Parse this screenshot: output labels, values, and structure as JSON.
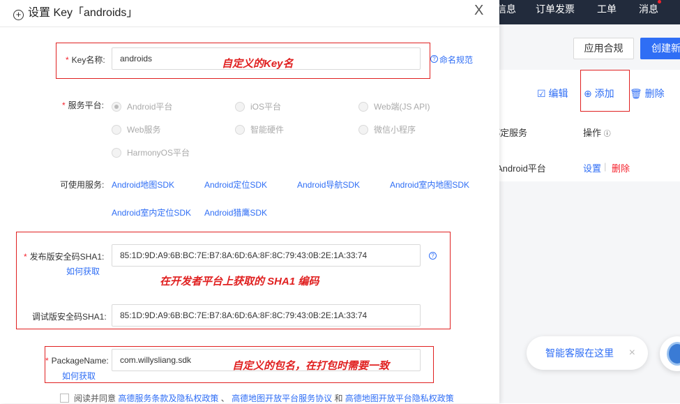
{
  "background": {
    "topnav": [
      "信息",
      "订单发票",
      "工单",
      "消息"
    ],
    "buttons": {
      "compliance": "应用合规",
      "create": "创建新"
    },
    "toolbar": {
      "edit": "编辑",
      "add": "添加",
      "delete": "删除"
    },
    "table": {
      "headers": {
        "service": "绑定服务",
        "actions": "操作"
      },
      "row": {
        "service": "Android平台",
        "settings": "设置",
        "delete": "删除"
      }
    },
    "chat": {
      "label": "智能客服在这里",
      "close": "×"
    }
  },
  "modal": {
    "title": "设置 Key「androids」",
    "close": "X",
    "key_name": {
      "label": "Key名称:",
      "value": "androids",
      "help": "命名规范",
      "annotation": "自定义的Key名"
    },
    "platform": {
      "label": "服务平台:",
      "options": [
        "Android平台",
        "iOS平台",
        "Web端(JS API)",
        "Web服务",
        "智能硬件",
        "微信小程序",
        "HarmonyOS平台"
      ],
      "selected": "Android平台"
    },
    "services": {
      "label": "可使用服务:",
      "items": [
        "Android地图SDK",
        "Android定位SDK",
        "Android导航SDK",
        "Android室内地图SDK",
        "Android室内定位SDK",
        "Android猎鹰SDK"
      ]
    },
    "sha1_release": {
      "label": "发布版安全码SHA1:",
      "value": "85:1D:9D:A9:6B:BC:7E:B7:8A:6D:6A:8F:8C:79:43:0B:2E:1A:33:74",
      "link": "如何获取"
    },
    "sha1_annotation": "在开发者平台上获取的 SHA1 编码",
    "sha1_debug": {
      "label": "调试版安全码SHA1:",
      "value": "85:1D:9D:A9:6B:BC:7E:B7:8A:6D:6A:8F:8C:79:43:0B:2E:1A:33:74"
    },
    "package": {
      "label": "PackageName:",
      "value": "com.willysliang.sdk",
      "link": "如何获取",
      "annotation": "自定义的包名，在打包时需要一致"
    },
    "agree": {
      "prefix": "阅读并同意",
      "link1": "高德服务条款及隐私权政策",
      "sep1": "、",
      "link2": "高德地图开放平台服务协议",
      "sep2": "和",
      "link3": "高德地图开放平台隐私权政策"
    }
  }
}
